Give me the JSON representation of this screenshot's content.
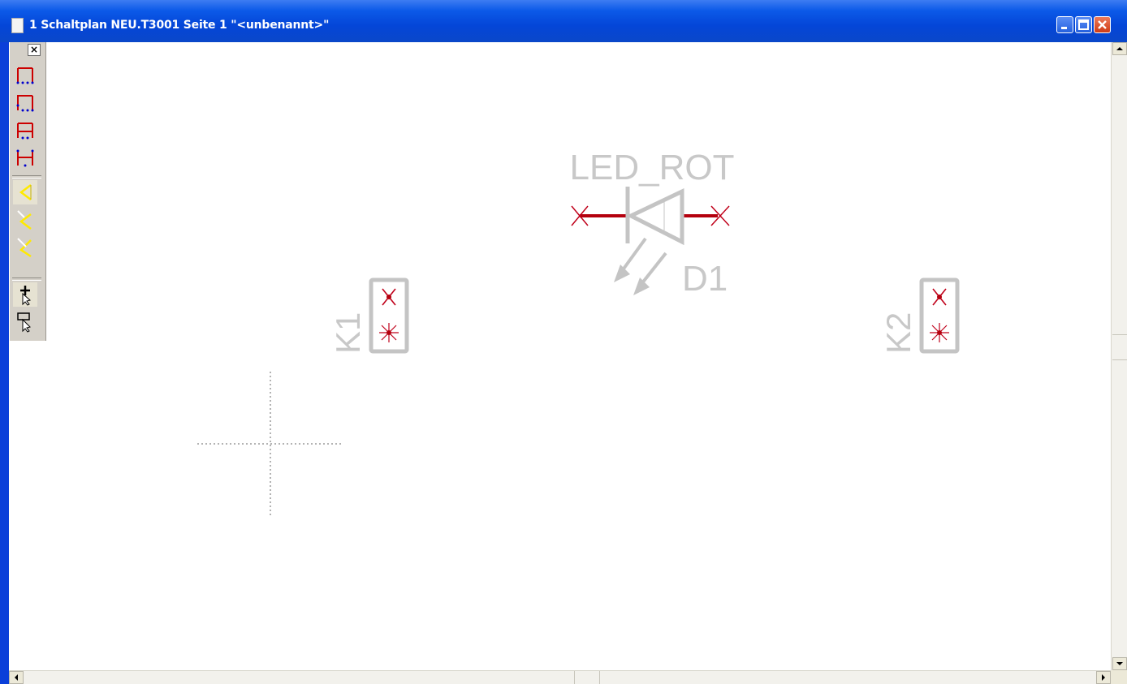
{
  "window": {
    "title": "1 Schaltplan NEU.T3001 Seite 1 \"<unbenannt>\"",
    "controls": {
      "minimize": "minimize-icon",
      "maximize": "maximize-icon",
      "close": "close-icon"
    }
  },
  "toolbar": {
    "close_label": "×",
    "tools": [
      "wire-tool-1-icon",
      "wire-tool-2-icon",
      "wire-tool-3-icon",
      "wire-tool-4-icon",
      "pin-tool-1-icon",
      "pin-tool-2-icon",
      "pin-tool-3-icon",
      "select-add-icon",
      "select-part-icon"
    ]
  },
  "schematic": {
    "components": [
      {
        "ref": "D1",
        "value": "LED_ROT",
        "type": "led"
      },
      {
        "ref": "K1",
        "type": "connector"
      },
      {
        "ref": "K2",
        "type": "connector"
      }
    ],
    "colors": {
      "symbol": "#c4c4c4",
      "pin": "#c0001a",
      "text": "#c8c8c8",
      "crosshair": "#9a9a9a"
    }
  },
  "scrollbars": {
    "vertical": true,
    "horizontal": true
  }
}
